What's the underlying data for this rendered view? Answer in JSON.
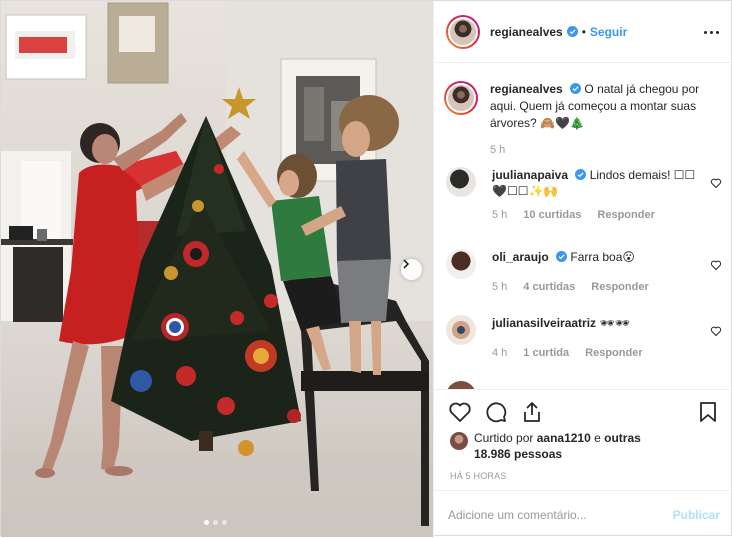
{
  "header": {
    "username": "regianealves",
    "follow_label": "Seguir",
    "separator": "•"
  },
  "caption": {
    "username": "regianealves",
    "text": "O natal já chegou por aqui. Quem já começou a montar suas árvores? 🙈🖤🎄",
    "time": "5 h"
  },
  "comments": [
    {
      "username": "juulianapaiva",
      "text": "Lindos demais! ☐☐🖤☐☐✨🙌",
      "time": "5 h",
      "likes": "10 curtidas",
      "reply": "Responder",
      "verified": true
    },
    {
      "username": "oli_araujo",
      "text": "Farra boa😮",
      "time": "5 h",
      "likes": "4 curtidas",
      "reply": "Responder",
      "verified": true
    },
    {
      "username": "julianasilveiraatriz",
      "text": "🕶🕶",
      "time": "4 h",
      "likes": "1 curtida",
      "reply": "Responder",
      "verified": false
    }
  ],
  "likes": {
    "prefix": "Curtido por",
    "user": "aana1210",
    "connector": "e",
    "others": "outras 18.986 pessoas"
  },
  "time_ago": "HÁ 5 HORAS",
  "comment_box": {
    "placeholder": "Adicione um comentário...",
    "post_label": "Publicar"
  },
  "carousel": {
    "total": 3,
    "active": 1
  },
  "colors": {
    "accent": "#3897f0",
    "muted": "#999999",
    "text": "#262626"
  },
  "icons": [
    "verified-icon",
    "more-icon",
    "heart-icon",
    "comment-icon",
    "share-icon",
    "bookmark-icon",
    "chevron-right-icon"
  ]
}
